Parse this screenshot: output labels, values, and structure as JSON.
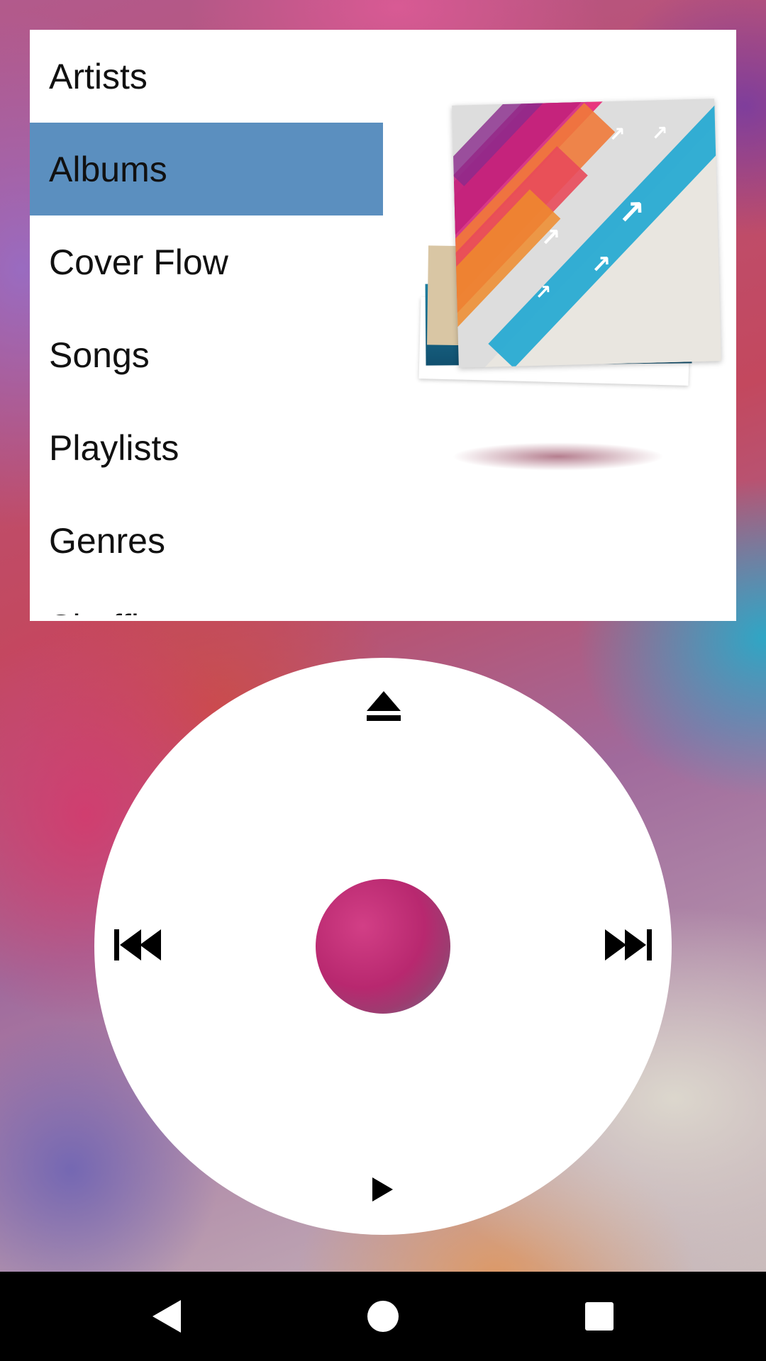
{
  "menu": {
    "items": [
      {
        "label": "Artists"
      },
      {
        "label": "Albums",
        "selected": true
      },
      {
        "label": "Cover Flow"
      },
      {
        "label": "Songs"
      },
      {
        "label": "Playlists"
      },
      {
        "label": "Genres"
      },
      {
        "label": "Shuffle",
        "partially_visible": true
      }
    ]
  },
  "wheel": {
    "top_icon": "eject-icon",
    "left_icon": "previous-track-icon",
    "right_icon": "next-track-icon",
    "bottom_icon": "play-icon",
    "center_icon": "select-button"
  },
  "navbar": {
    "back_icon": "back-triangle-icon",
    "home_icon": "home-circle-icon",
    "recents_icon": "recents-square-icon"
  },
  "colors": {
    "selection": "#5b8fbf",
    "panel": "#ffffff",
    "wheel": "#ffffff",
    "center_button": "#b8286f",
    "navbar": "#000000"
  }
}
